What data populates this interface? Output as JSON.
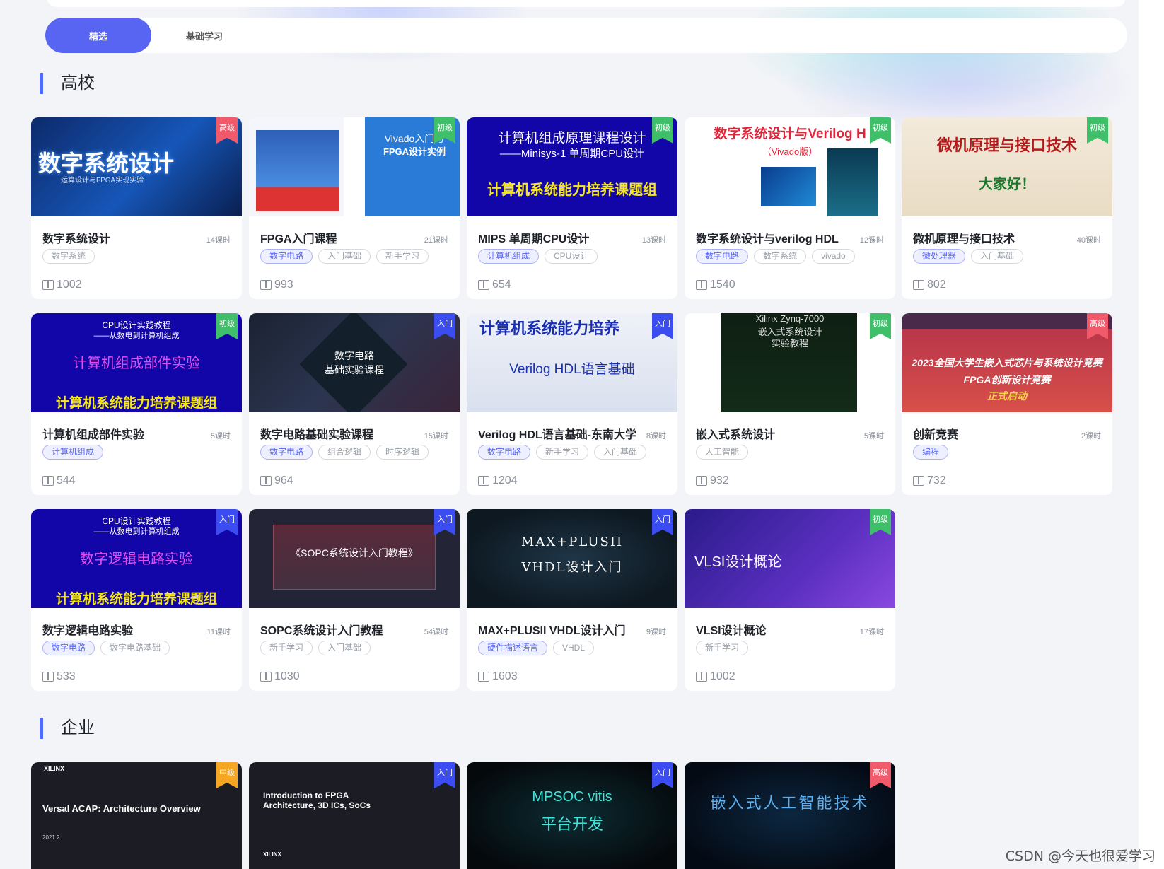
{
  "tabs": [
    {
      "label": "精选"
    },
    {
      "label": "基础学习"
    }
  ],
  "sections": {
    "university": "高校",
    "enterprise": "企业"
  },
  "cards": [
    {
      "title": "数字系统设计",
      "hours": "14课时",
      "tags": [
        "数字系统"
      ],
      "views": "1002",
      "level": "高级",
      "thumb": [
        "数字系统设计",
        "运算设计与FPGA实现实验"
      ]
    },
    {
      "title": "FPGA入门课程",
      "hours": "21课时",
      "tags": [
        "数字电路",
        "入门基础",
        "新手学习"
      ],
      "views": "993",
      "level": "初级",
      "thumb": [
        "Vivado入门与",
        "FPGA设计实例"
      ]
    },
    {
      "title": "MIPS 单周期CPU设计",
      "hours": "13课时",
      "tags": [
        "计算机组成",
        "CPU设计"
      ],
      "views": "654",
      "level": "初级",
      "thumb": [
        "计算机组成原理课程设计",
        "——Minisys-1 单周期CPU设计",
        "计算机系统能力培养课题组"
      ]
    },
    {
      "title": "数字系统设计与verilog HDL",
      "hours": "12课时",
      "tags": [
        "数字电路",
        "数字系统",
        "vivado"
      ],
      "views": "1540",
      "level": "初级",
      "thumb": [
        "数字系统设计与Verilog H",
        "（Vivado版）"
      ]
    },
    {
      "title": "微机原理与接口技术",
      "hours": "40课时",
      "tags": [
        "微处理器",
        "入门基础"
      ],
      "views": "802",
      "level": "初级",
      "thumb": [
        "微机原理与接口技术",
        "大家好！"
      ]
    },
    {
      "title": "计算机组成部件实验",
      "hours": "5课时",
      "tags": [
        "计算机组成"
      ],
      "views": "544",
      "level": "初级",
      "thumb": [
        "CPU设计实践教程",
        "——从数电到计算机组成",
        "计算机组成部件实验",
        "计算机系统能力培养课题组"
      ]
    },
    {
      "title": "数字电路基础实验课程",
      "hours": "15课时",
      "tags": [
        "数字电路",
        "组合逻辑",
        "时序逻辑"
      ],
      "views": "964",
      "level": "入门",
      "thumb": [
        "数字电路",
        "基础实验课程"
      ]
    },
    {
      "title": "Verilog HDL语言基础-东南大学",
      "hours": "8课时",
      "tags": [
        "数字电路",
        "新手学习",
        "入门基础"
      ],
      "views": "1204",
      "level": "入门",
      "thumb": [
        "计算机系统能力培养",
        "Verilog HDL语言基础"
      ]
    },
    {
      "title": "嵌入式系统设计",
      "hours": "5课时",
      "tags": [
        "人工智能"
      ],
      "views": "932",
      "level": "初级",
      "thumb": [
        "Xilinx Zynq-7000",
        "嵌入式系统设计",
        "实验教程"
      ]
    },
    {
      "title": "创新竞赛",
      "hours": "2课时",
      "tags": [
        "编程"
      ],
      "views": "732",
      "level": "高级",
      "thumb": [
        "2023全国大学生嵌入式芯片与系统设计竞赛",
        "FPGA创新设计竞赛",
        "正式启动"
      ]
    },
    {
      "title": "数字逻辑电路实验",
      "hours": "11课时",
      "tags": [
        "数字电路",
        "数字电路基础"
      ],
      "views": "533",
      "level": "入门",
      "thumb": [
        "CPU设计实践教程",
        "——从数电到计算机组成",
        "数字逻辑电路实验",
        "计算机系统能力培养课题组"
      ]
    },
    {
      "title": "SOPC系统设计入门教程",
      "hours": "54课时",
      "tags": [
        "新手学习",
        "入门基础"
      ],
      "views": "1030",
      "level": "入门",
      "thumb": [
        "《SOPC系统设计入门教程》"
      ]
    },
    {
      "title": "MAX+PLUSII VHDL设计入门",
      "hours": "9课时",
      "tags": [
        "硬件描述语言",
        "VHDL"
      ],
      "views": "1603",
      "level": "入门",
      "thumb": [
        "MAX+PLUSII",
        "VHDL设计入门"
      ]
    },
    {
      "title": "VLSI设计概论",
      "hours": "17课时",
      "tags": [
        "新手学习"
      ],
      "views": "1002",
      "level": "初级",
      "thumb": [
        "VLSI设计概论"
      ]
    }
  ],
  "enterprise_cards": [
    {
      "level": "中级",
      "thumb": [
        "XILINX",
        "Versal ACAP: Architecture Overview",
        "2021.2"
      ]
    },
    {
      "level": "入门",
      "thumb": [
        "Introduction to FPGA",
        "Architecture, 3D ICs, SoCs",
        "XILINX"
      ]
    },
    {
      "level": "入门",
      "thumb": [
        "MPSOC vitis",
        "平台开发"
      ]
    },
    {
      "level": "高级",
      "thumb": [
        "嵌入式人工智能技术"
      ]
    }
  ],
  "watermark": "CSDN @今天也很爱学习",
  "colors": {
    "accent": "#5865f2",
    "badge_green": "#3fbf6a",
    "badge_blue": "#3b4df0",
    "badge_red": "#f05a6a",
    "badge_orange": "#f5a623"
  }
}
